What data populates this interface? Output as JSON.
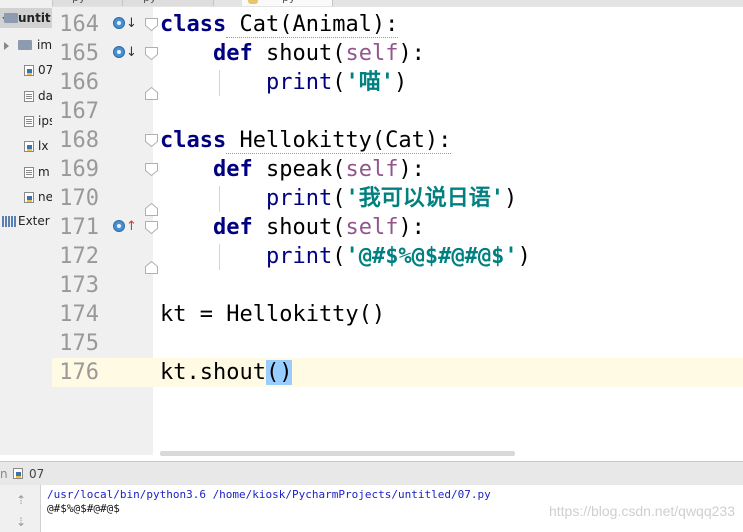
{
  "sidebar": {
    "root_label": "untit",
    "items": [
      {
        "label": "im",
        "icon": "folder-icon",
        "expander": true
      },
      {
        "label": "07",
        "icon": "python-file-icon"
      },
      {
        "label": "da",
        "icon": "text-file-icon"
      },
      {
        "label": "ips",
        "icon": "text-file-icon"
      },
      {
        "label": "lx",
        "icon": "python-file-icon"
      },
      {
        "label": "m",
        "icon": "text-file-icon"
      },
      {
        "label": "ne",
        "icon": "python-file-icon"
      }
    ],
    "external": "Exter"
  },
  "tabs": [
    {
      "label": "py"
    },
    {
      "label": "py"
    },
    {
      "label": "py"
    }
  ],
  "editor": {
    "lines": [
      {
        "no": "164",
        "marker": "override-down"
      },
      {
        "no": "165",
        "marker": "override-down"
      },
      {
        "no": "166",
        "marker": ""
      },
      {
        "no": "167",
        "marker": ""
      },
      {
        "no": "168",
        "marker": ""
      },
      {
        "no": "169",
        "marker": ""
      },
      {
        "no": "170",
        "marker": ""
      },
      {
        "no": "171",
        "marker": "override-up"
      },
      {
        "no": "172",
        "marker": ""
      },
      {
        "no": "173",
        "marker": ""
      },
      {
        "no": "174",
        "marker": ""
      },
      {
        "no": "175",
        "marker": ""
      },
      {
        "no": "176",
        "marker": ""
      }
    ],
    "code": {
      "l164": {
        "kw": "class",
        "rest": " Cat(Animal):"
      },
      "l165": {
        "kw": "def",
        "name": " shout(",
        "self": "self",
        "end": "):"
      },
      "l166": {
        "fn": "print",
        "open": "(",
        "str": "'喵'",
        "close": ")"
      },
      "l168": {
        "kw": "class",
        "rest": " Hellokitty(Cat):"
      },
      "l169": {
        "kw": "def",
        "name": " speak(",
        "self": "self",
        "end": "):"
      },
      "l170": {
        "fn": "print",
        "open": "(",
        "str": "'我可以说日语'",
        "close": ")"
      },
      "l171": {
        "kw": "def",
        "name": " shout(",
        "self": "self",
        "end": "):"
      },
      "l172": {
        "fn": "print",
        "open": "(",
        "str": "'@#$%@$#@#@$'",
        "close": ")"
      },
      "l174": {
        "text": "kt = Hellokitty()"
      },
      "l176": {
        "text": "kt.shout",
        "paren": "()"
      }
    },
    "colors": {
      "keyword": "#000080",
      "self": "#94558d",
      "string": "#008080",
      "line_number": "#999999",
      "current_line": "#fffae3",
      "paren_match": "#99ccff"
    }
  },
  "run": {
    "tab_label": "07",
    "command": "/usr/local/bin/python3.6 /home/kiosk/PycharmProjects/untitled/07.py",
    "output": "@#$%@$#@#@$"
  },
  "watermark": "https://blog.csdn.net/qwqq233"
}
